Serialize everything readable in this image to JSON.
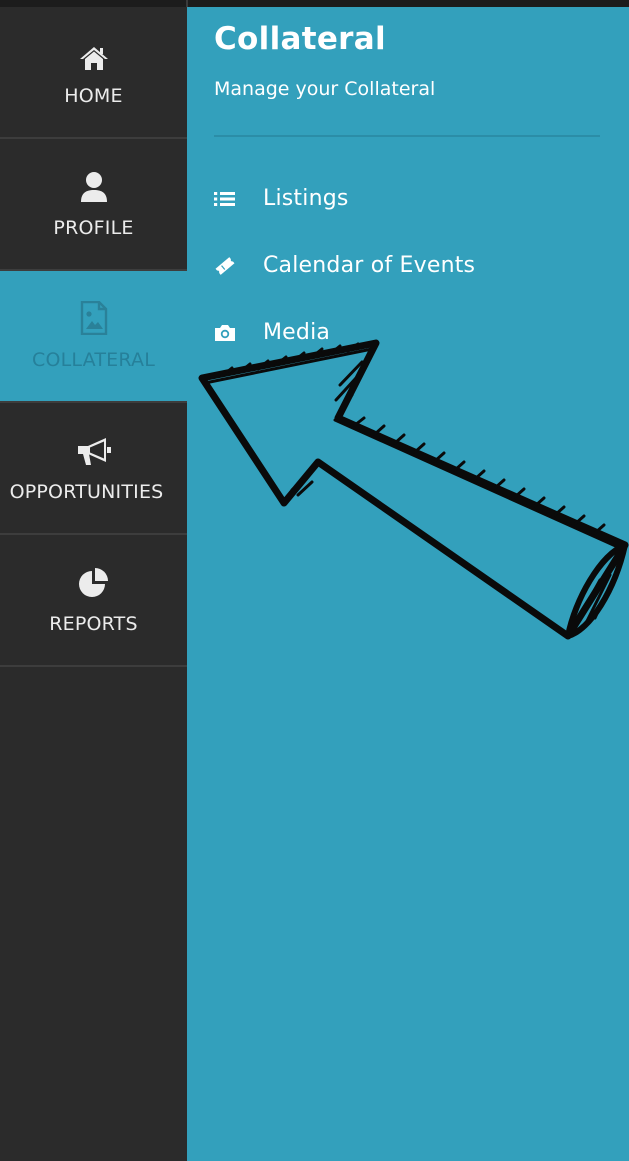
{
  "sidebar": {
    "items": [
      {
        "label": "HOME",
        "icon": "home-icon",
        "active": false
      },
      {
        "label": "PROFILE",
        "icon": "user-icon",
        "active": false
      },
      {
        "label": "COLLATERAL",
        "icon": "image-file-icon",
        "active": true
      },
      {
        "label": "OPPORTUNITIES",
        "icon": "megaphone-icon",
        "active": false
      },
      {
        "label": "REPORTS",
        "icon": "pie-chart-icon",
        "active": false
      }
    ]
  },
  "panel": {
    "title": "Collateral",
    "subtitle": "Manage your Collateral",
    "menu": [
      {
        "label": "Listings",
        "icon": "list-icon"
      },
      {
        "label": "Calendar of Events",
        "icon": "ticket-icon"
      },
      {
        "label": "Media",
        "icon": "camera-icon"
      }
    ]
  },
  "colors": {
    "sidebar_bg": "#2b2b2b",
    "accent": "#33a0bc",
    "text": "#ffffff"
  }
}
